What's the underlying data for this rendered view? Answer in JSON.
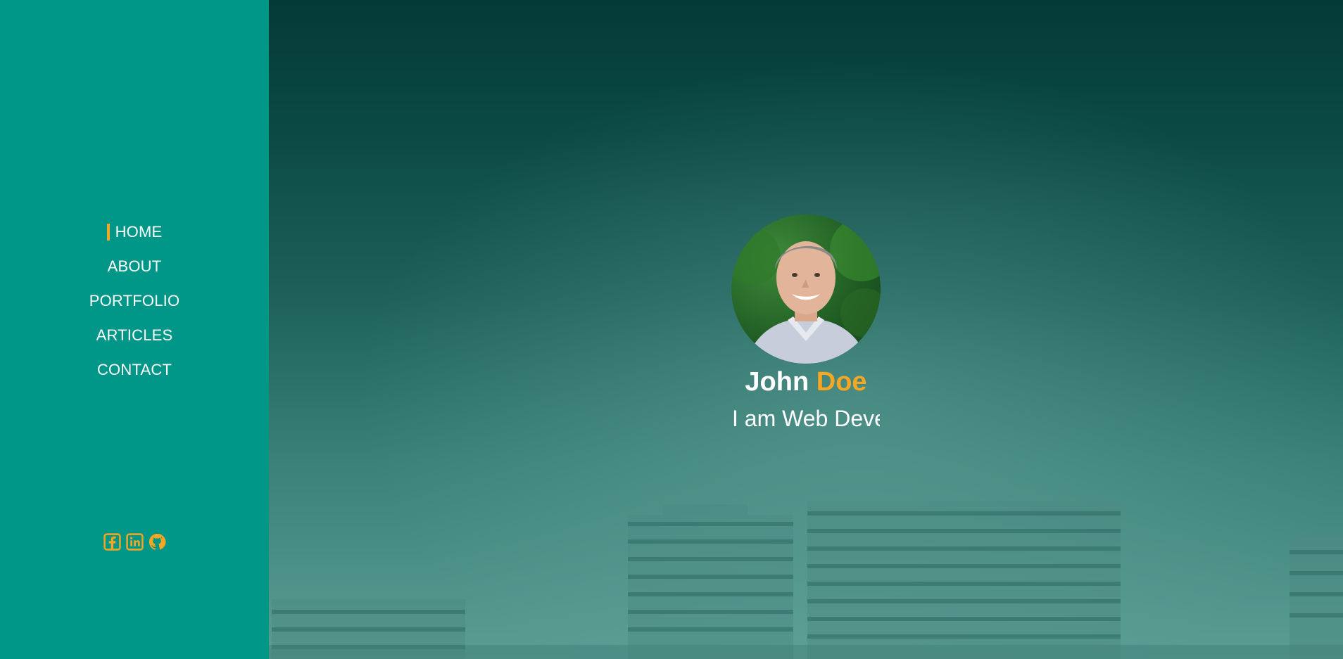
{
  "nav": {
    "items": [
      {
        "label": "HOME",
        "active": true
      },
      {
        "label": "ABOUT"
      },
      {
        "label": "PORTFOLIO"
      },
      {
        "label": "ARTICLES"
      },
      {
        "label": "CONTACT"
      }
    ]
  },
  "social": {
    "icons": [
      "facebook-icon",
      "linkedin-icon",
      "github-icon"
    ]
  },
  "profile": {
    "first_name": "John",
    "last_name": "Doe",
    "tagline": "I am Web Developer"
  },
  "colors": {
    "sidebar": "#009688",
    "accent": "#f5a623",
    "text": "#ffffff"
  }
}
